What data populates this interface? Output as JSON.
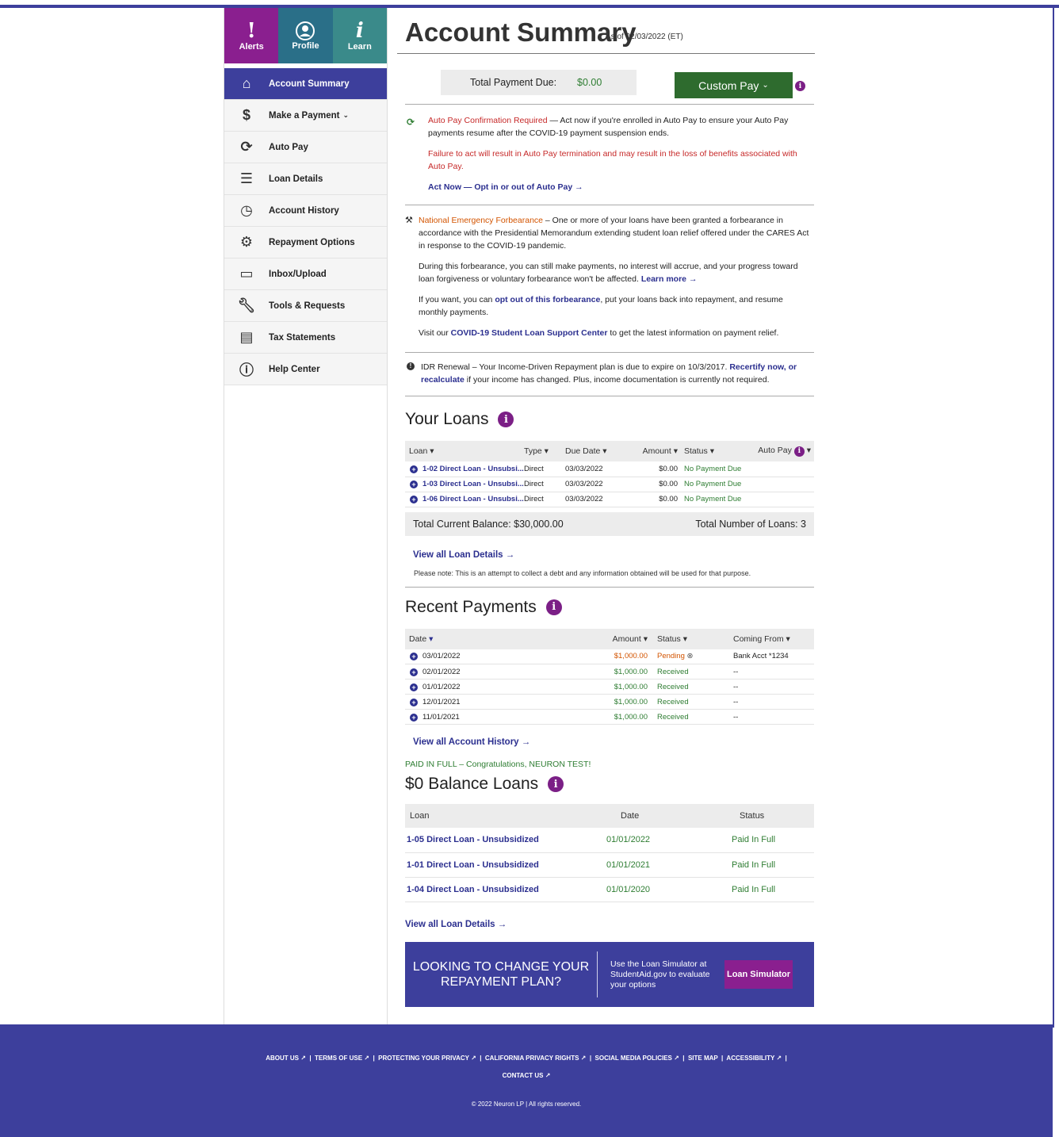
{
  "header": {
    "title": "Account Summary",
    "as_of": "As of 02/03/2022 (ET)"
  },
  "tiles": {
    "alerts": "Alerts",
    "profile": "Profile",
    "learn": "Learn"
  },
  "sidebar": {
    "items": [
      {
        "label": "Account Summary",
        "icon": "home-icon"
      },
      {
        "label": "Make a Payment",
        "icon": "dollar-icon"
      },
      {
        "label": "Auto Pay",
        "icon": "autopay-icon"
      },
      {
        "label": "Loan Details",
        "icon": "list-icon"
      },
      {
        "label": "Account History",
        "icon": "clock-icon"
      },
      {
        "label": "Repayment Options",
        "icon": "gear-icon"
      },
      {
        "label": "Inbox/Upload",
        "icon": "inbox-icon"
      },
      {
        "label": "Tools & Requests",
        "icon": "wrench-icon"
      },
      {
        "label": "Tax Statements",
        "icon": "document-icon"
      },
      {
        "label": "Help Center",
        "icon": "help-icon"
      }
    ]
  },
  "payment": {
    "due_label": "Total Payment Due:",
    "due_value": "$0.00",
    "custom_pay": "Custom Pay"
  },
  "alerts": {
    "autopay_title": "Auto Pay Confirmation Required",
    "autopay_text": " — Act now if you're enrolled in Auto Pay to ensure your Auto Pay payments resume after the COVID-19 payment suspension ends.",
    "autopay_warning": "Failure to act will result in Auto Pay termination and may result in the loss of benefits associated with Auto Pay.",
    "autopay_link": "Act Now — Opt in or out of Auto Pay",
    "forb_title": "National Emergency Forbearance",
    "forb_text": " – One or more of your loans have been granted a forbearance in accordance with the Presidential Memorandum extending student loan relief offered under the CARES Act in response to the COVID-19 pandemic.",
    "forb_p2": "During this forbearance, you can still make payments, no interest will accrue, and your progress toward loan forgiveness or voluntary forbearance won't be affected. ",
    "forb_learn": "Learn more",
    "forb_p3a": "If you want, you can ",
    "forb_optout": "opt out of this forbearance",
    "forb_p3b": ", put your loans back into repayment, and resume monthly payments.",
    "forb_p4a": "Visit our ",
    "forb_center": "COVID-19 Student Loan Support Center",
    "forb_p4b": " to get the latest information on payment relief.",
    "idr_text": "IDR Renewal – Your Income-Driven Repayment plan is due to expire on 10/3/2017. ",
    "idr_link": "Recertify now, or recalculate",
    "idr_tail": " if your income has changed. Plus, income documentation is currently not required."
  },
  "loans": {
    "title": "Your Loans",
    "columns": [
      "Loan",
      "Type",
      "Due Date",
      "Amount",
      "Status",
      "Auto Pay"
    ],
    "rows": [
      [
        "1-02 Direct Loan - Unsubsi...",
        "Direct",
        "03/03/2022",
        "$0.00",
        "No Payment Due"
      ],
      [
        "1-03 Direct Loan - Unsubsi...",
        "Direct",
        "03/03/2022",
        "$0.00",
        "No Payment Due"
      ],
      [
        "1-06 Direct Loan - Unsubsi...",
        "Direct",
        "03/03/2022",
        "$0.00",
        "No Payment Due"
      ]
    ],
    "total_balance": "Total Current Balance:  $30,000.00",
    "total_loans": "Total Number of Loans:  3",
    "view_all": "View all Loan Details",
    "note": "Please note: This is an attempt to collect a debt and any information obtained will be used for that purpose."
  },
  "payments": {
    "title": "Recent Payments",
    "columns": [
      "Date",
      "Amount",
      "Status",
      "Coming From"
    ],
    "rows": [
      [
        "03/01/2022",
        "$1,000.00",
        "Pending",
        "Bank Acct *1234"
      ],
      [
        "02/01/2022",
        "$1,000.00",
        "Received",
        "--"
      ],
      [
        "01/01/2022",
        "$1,000.00",
        "Received",
        "--"
      ],
      [
        "12/01/2021",
        "$1,000.00",
        "Received",
        "--"
      ],
      [
        "11/01/2021",
        "$1,000.00",
        "Received",
        "--"
      ]
    ],
    "view_all": "View all Account History"
  },
  "zero": {
    "paid_msg": "PAID IN FULL – Congratulations, NEURON TEST!",
    "title": "$0 Balance Loans",
    "columns": [
      "Loan",
      "Date",
      "Status"
    ],
    "rows": [
      [
        "1-05 Direct Loan - Unsubsidized",
        "01/01/2022",
        "Paid In Full"
      ],
      [
        "1-01 Direct Loan - Unsubsidized",
        "01/01/2021",
        "Paid In Full"
      ],
      [
        "1-04 Direct Loan - Unsubsidized",
        "01/01/2020",
        "Paid In Full"
      ]
    ],
    "view_all": "View all Loan Details"
  },
  "banner": {
    "headline": "LOOKING TO CHANGE YOUR REPAYMENT PLAN?",
    "text": "Use the Loan Simulator at StudentAid.gov to evaluate your options",
    "button": "Loan Simulator"
  },
  "footer": {
    "links": [
      "ABOUT US",
      "TERMS OF USE",
      "PROTECTING YOUR PRIVACY",
      "CALIFORNIA PRIVACY RIGHTS",
      "SOCIAL MEDIA POLICIES",
      "SITE MAP",
      "ACCESSIBILITY",
      "CONTACT US"
    ],
    "copyright": "© 2022 Neuron LP | All rights reserved."
  }
}
